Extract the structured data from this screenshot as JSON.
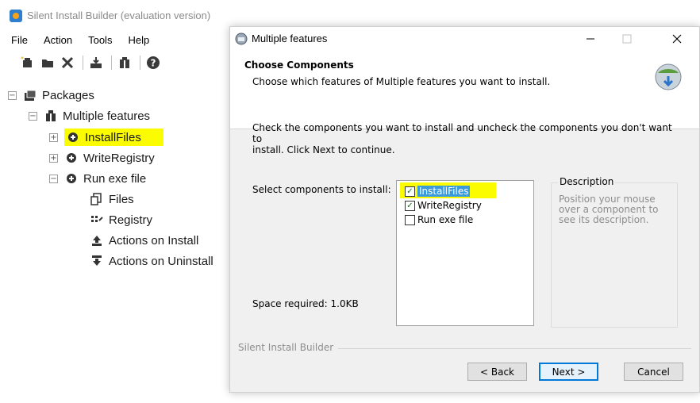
{
  "app": {
    "title": "Silent Install Builder (evaluation version)",
    "menu": [
      "File",
      "Action",
      "Tools",
      "Help"
    ],
    "toolbar_icons": [
      "new-package-icon",
      "open-package-icon",
      "delete-icon",
      "build-icon",
      "package-icon",
      "help-icon"
    ],
    "tree": {
      "root": "Packages",
      "package": "Multiple features",
      "features": [
        {
          "label": "InstallFiles",
          "highlighted": true
        },
        {
          "label": "WriteRegistry"
        },
        {
          "label": "Run exe file"
        }
      ],
      "run_exe_children": [
        "Files",
        "Registry",
        "Actions on Install",
        "Actions on Uninstall"
      ]
    }
  },
  "dialog": {
    "title": "Multiple features",
    "header_title": "Choose Components",
    "header_subtitle": "Choose which features of Multiple features you want to install.",
    "intro_line1": "Check the components you want to install and uncheck the components you don't want to",
    "intro_line2": "install. Click Next to continue.",
    "select_label": "Select components to install:",
    "space_required": "Space required: 1.0KB",
    "components": [
      {
        "label": "InstallFiles",
        "checked": true,
        "highlighted": true
      },
      {
        "label": "WriteRegistry",
        "checked": true
      },
      {
        "label": "Run exe file",
        "checked": false
      }
    ],
    "description_title": "Description",
    "description_text": "Position your mouse over a component to see its description.",
    "brand": "Silent Install Builder",
    "buttons": {
      "back": "< Back",
      "next": "Next >",
      "cancel": "Cancel"
    },
    "colors": {
      "highlight": "#fcfc00",
      "selection": "#3b9ad9",
      "default_button_border": "#0078d7"
    }
  }
}
